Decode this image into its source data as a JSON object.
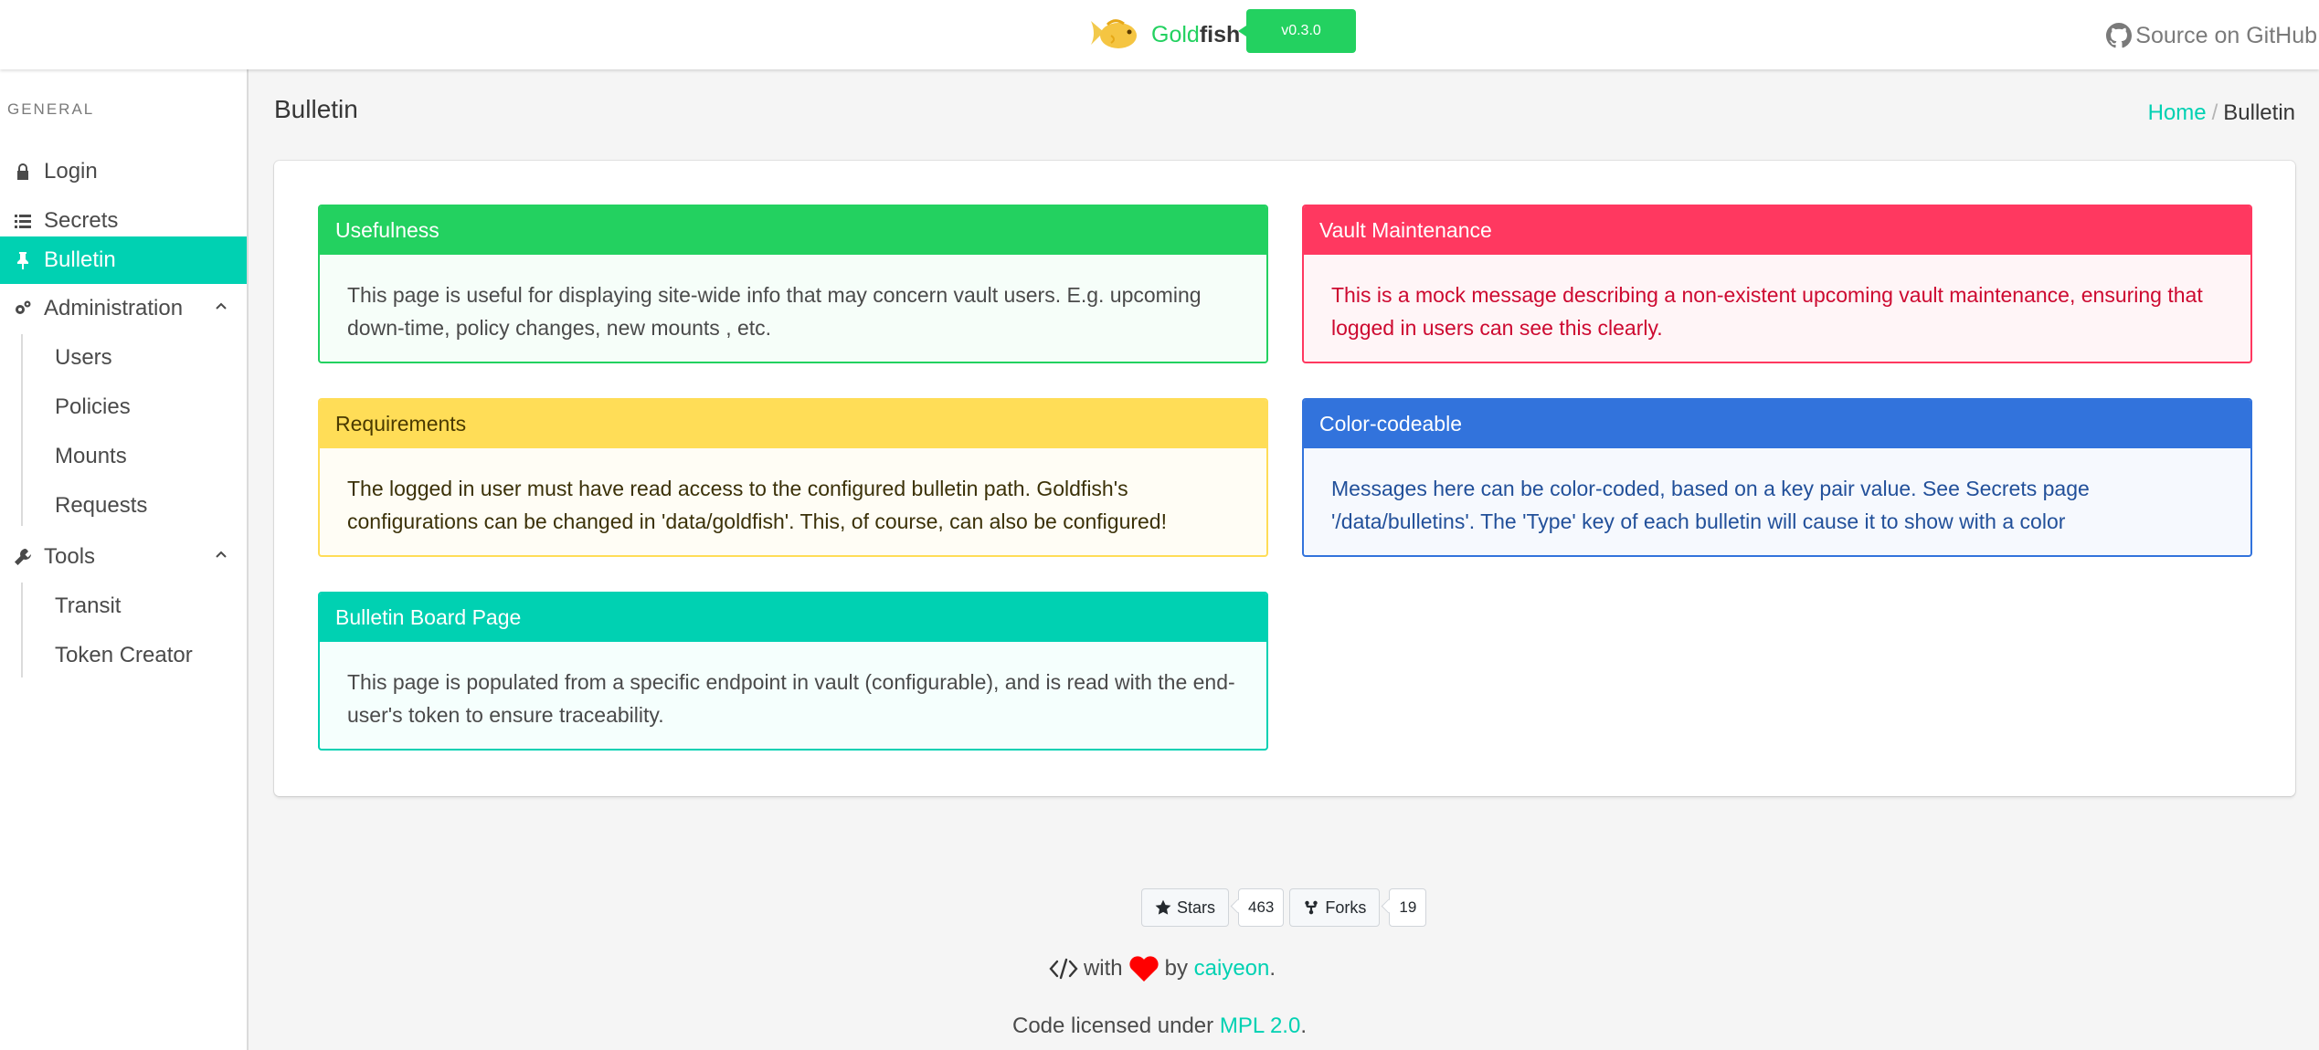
{
  "header": {
    "brand_gold": "Gold",
    "brand_fish": "fish",
    "version": "v0.3.0",
    "github_link": "Source on GitHub",
    "logo_icon": "goldfish-logo-icon",
    "github_icon": "github-icon"
  },
  "sidebar": {
    "section_label": "General",
    "items": [
      {
        "label": "Login",
        "icon": "lock-icon"
      },
      {
        "label": "Secrets",
        "icon": "list-icon"
      },
      {
        "label": "Bulletin",
        "icon": "pin-icon",
        "active": true
      },
      {
        "label": "Administration",
        "icon": "cogs-icon",
        "expanded": true,
        "children": [
          {
            "label": "Users"
          },
          {
            "label": "Policies"
          },
          {
            "label": "Mounts"
          },
          {
            "label": "Requests"
          }
        ]
      },
      {
        "label": "Tools",
        "icon": "wrench-icon",
        "expanded": true,
        "children": [
          {
            "label": "Transit"
          },
          {
            "label": "Token Creator"
          }
        ]
      }
    ]
  },
  "main": {
    "title": "Bulletin",
    "breadcrumb": {
      "home": "Home",
      "separator": "/",
      "current": "Bulletin"
    },
    "messages": [
      {
        "type": "success",
        "title": "Usefulness",
        "body": "This page is useful for displaying site-wide info that may concern vault users. E.g. upcoming down-time, policy changes, new mounts , etc."
      },
      {
        "type": "danger",
        "title": "Vault Maintenance",
        "body": "This is a mock message describing a non-existent upcoming vault maintenance, ensuring that logged in users can see this clearly."
      },
      {
        "type": "warning",
        "title": "Requirements",
        "body": "The logged in user must have read access to the configured bulletin path. Goldfish's configurations can be changed in 'data/goldfish'. This, of course, can also be configured!"
      },
      {
        "type": "info",
        "title": "Color-codeable",
        "body": "Messages here can be color-coded, based on a key pair value. See Secrets page '/data/bulletins'. The 'Type' key of each bulletin will cause it to show with a color"
      },
      {
        "type": "primary",
        "title": "Bulletin Board Page",
        "body": "This page is populated from a specific endpoint in vault (configurable), and is read with the end-user's token to ensure traceability."
      }
    ]
  },
  "footer": {
    "stars_label": "Stars",
    "stars_count": "463",
    "forks_label": "Forks",
    "forks_count": "19",
    "made_with": "with",
    "by": "by",
    "author": "caiyeon",
    "license_prefix": "Code licensed under",
    "license": "MPL 2.0",
    "period": "."
  },
  "colors": {
    "primary": "#00d1b2",
    "success": "#23d160",
    "danger": "#ff3860",
    "warning": "#ffdd57",
    "info": "#3273dc"
  }
}
